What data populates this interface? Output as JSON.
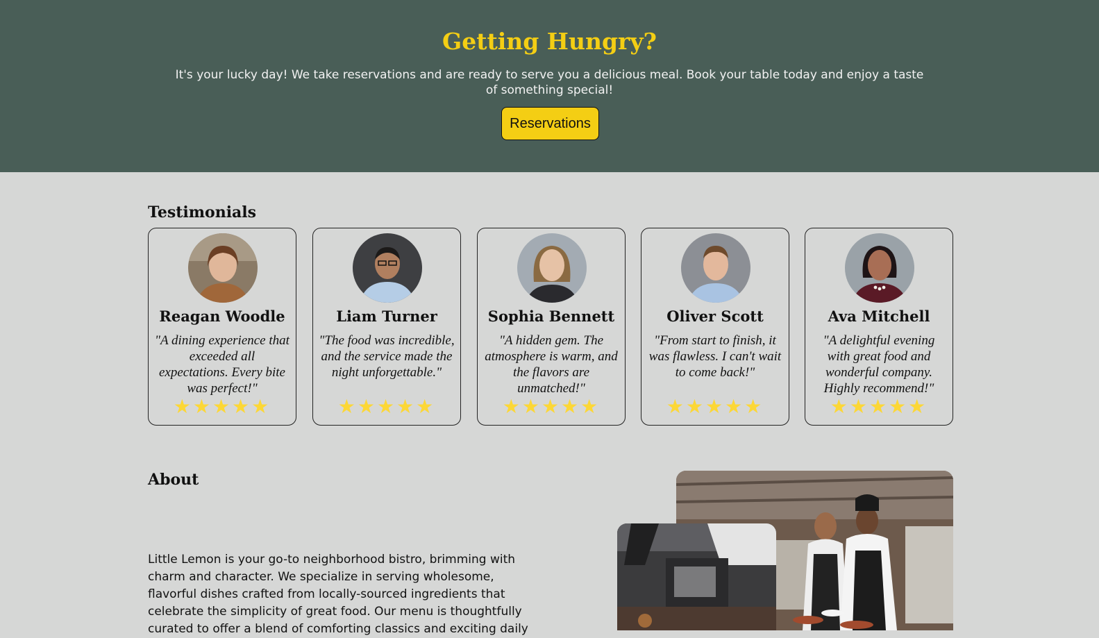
{
  "hero": {
    "title": "Getting Hungry?",
    "text": "It's your lucky day! We take reservations and are ready to serve you a delicious meal. Book your table today and enjoy a taste of something special!",
    "button_label": "Reservations"
  },
  "testimonials": {
    "title": "Testimonials",
    "items": [
      {
        "name": "Reagan Woodle",
        "quote": "\"A dining experience that exceeded all expectations. Every bite was perfect!\"",
        "rating": 5,
        "stars": "★★★★★"
      },
      {
        "name": "Liam Turner",
        "quote": "\"The food was incredible, and the service made the night unforgettable.\"",
        "rating": 5,
        "stars": "★★★★★"
      },
      {
        "name": "Sophia Bennett",
        "quote": "\"A hidden gem. The atmosphere is warm, and the flavors are unmatched!\"",
        "rating": 5,
        "stars": "★★★★★"
      },
      {
        "name": "Oliver Scott",
        "quote": "\"From start to finish, it was flawless. I can't wait to come back!\"",
        "rating": 5,
        "stars": "★★★★★"
      },
      {
        "name": "Ava Mitchell",
        "quote": "\"A delightful evening with great food and wonderful company. Highly recommend!\"",
        "rating": 5,
        "stars": "★★★★★"
      }
    ]
  },
  "about": {
    "title": "About",
    "text": "Little Lemon is your go-to neighborhood bistro, brimming with charm and character. We specialize in serving wholesome, flavorful dishes crafted from locally-sourced ingredients that celebrate the simplicity of great food. Our menu is thoughtfully curated to offer a blend of comforting classics and exciting daily"
  },
  "colors": {
    "hero_bg": "#495e57",
    "accent": "#f4ce14",
    "page_bg": "#d6d7d6",
    "star": "#fcd736"
  }
}
